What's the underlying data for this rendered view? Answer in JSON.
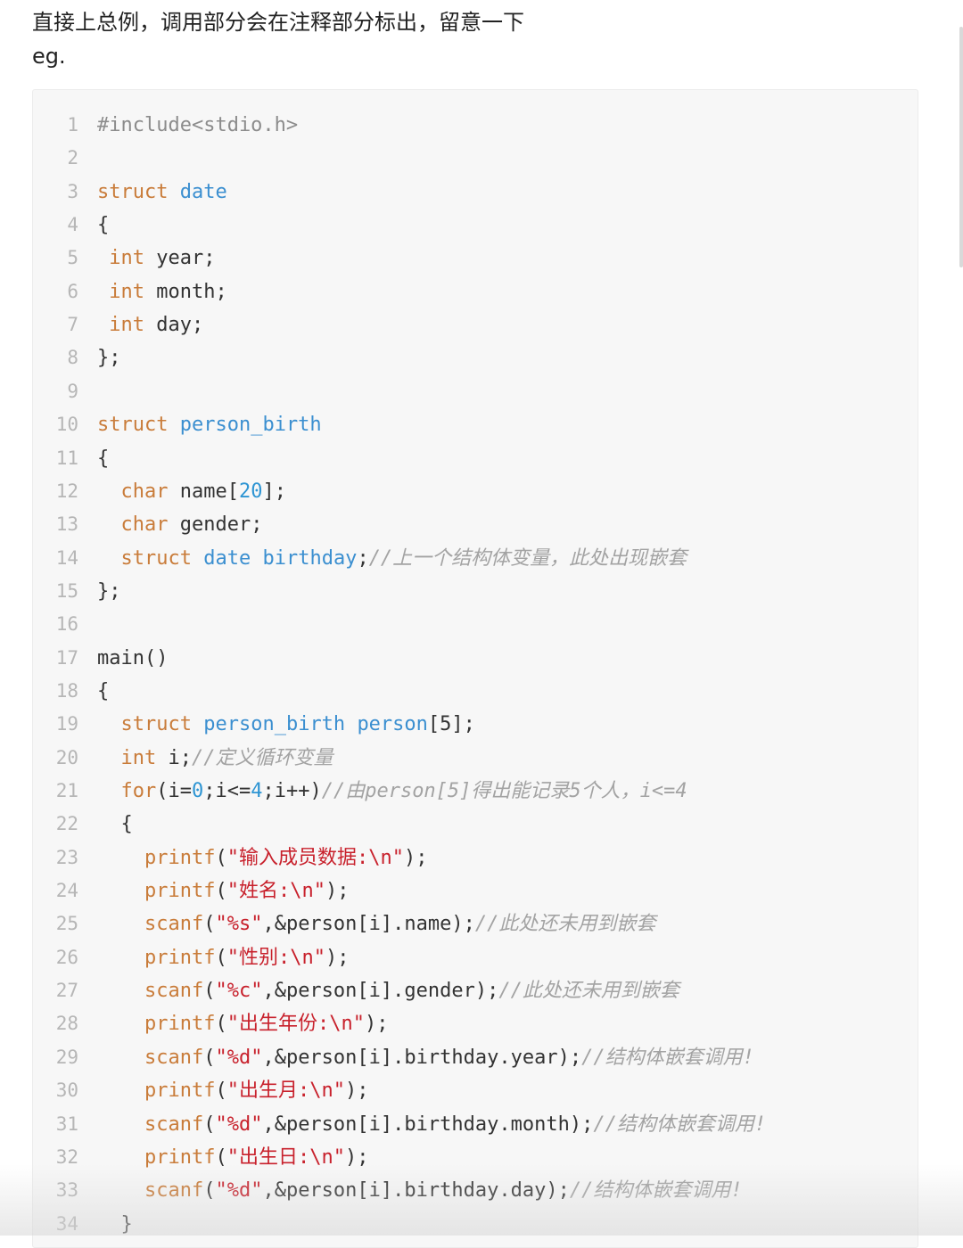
{
  "intro": {
    "line1": "直接上总例，调用部分会在注释部分标出，留意一下",
    "line2": "eg."
  },
  "colors": {
    "keyword": "#c97c3a",
    "type": "#3b8fd0",
    "number": "#2e95d3",
    "string": "#c8212c",
    "comment": "#a3a3a3",
    "preprocessor": "#8c8c8c",
    "text": "#333333",
    "line_number": "#b6b6b6",
    "code_background": "#f7f7f7"
  },
  "code": {
    "language": "c",
    "lines": [
      {
        "n": "1",
        "tokens": [
          {
            "t": "#include<stdio.h>",
            "c": "pre"
          }
        ]
      },
      {
        "n": "2",
        "tokens": []
      },
      {
        "n": "3",
        "tokens": [
          {
            "t": "struct",
            "c": "kw"
          },
          {
            "t": " "
          },
          {
            "t": "date",
            "c": "ty"
          }
        ]
      },
      {
        "n": "4",
        "tokens": [
          {
            "t": "{"
          }
        ]
      },
      {
        "n": "5",
        "tokens": [
          {
            "t": " "
          },
          {
            "t": "int",
            "c": "kw"
          },
          {
            "t": " year;"
          }
        ]
      },
      {
        "n": "6",
        "tokens": [
          {
            "t": " "
          },
          {
            "t": "int",
            "c": "kw"
          },
          {
            "t": " month;"
          }
        ]
      },
      {
        "n": "7",
        "tokens": [
          {
            "t": " "
          },
          {
            "t": "int",
            "c": "kw"
          },
          {
            "t": " day;"
          }
        ]
      },
      {
        "n": "8",
        "tokens": [
          {
            "t": "};"
          }
        ]
      },
      {
        "n": "9",
        "tokens": []
      },
      {
        "n": "10",
        "tokens": [
          {
            "t": "struct",
            "c": "kw"
          },
          {
            "t": " "
          },
          {
            "t": "person_birth",
            "c": "ty"
          }
        ]
      },
      {
        "n": "11",
        "tokens": [
          {
            "t": "{"
          }
        ]
      },
      {
        "n": "12",
        "tokens": [
          {
            "t": "  "
          },
          {
            "t": "char",
            "c": "kw"
          },
          {
            "t": " name["
          },
          {
            "t": "20",
            "c": "num"
          },
          {
            "t": "];"
          }
        ]
      },
      {
        "n": "13",
        "tokens": [
          {
            "t": "  "
          },
          {
            "t": "char",
            "c": "kw"
          },
          {
            "t": " gender;"
          }
        ]
      },
      {
        "n": "14",
        "tokens": [
          {
            "t": "  "
          },
          {
            "t": "struct",
            "c": "kw"
          },
          {
            "t": " "
          },
          {
            "t": "date",
            "c": "ty"
          },
          {
            "t": " "
          },
          {
            "t": "birthday",
            "c": "ty"
          },
          {
            "t": ";"
          },
          {
            "t": "//上一个结构体变量，此处出现嵌套",
            "c": "cmt"
          }
        ]
      },
      {
        "n": "15",
        "tokens": [
          {
            "t": "};"
          }
        ]
      },
      {
        "n": "16",
        "tokens": []
      },
      {
        "n": "17",
        "tokens": [
          {
            "t": "main()"
          }
        ]
      },
      {
        "n": "18",
        "tokens": [
          {
            "t": "{"
          }
        ]
      },
      {
        "n": "19",
        "tokens": [
          {
            "t": "  "
          },
          {
            "t": "struct",
            "c": "kw"
          },
          {
            "t": " "
          },
          {
            "t": "person_birth",
            "c": "ty"
          },
          {
            "t": " "
          },
          {
            "t": "person",
            "c": "ty"
          },
          {
            "t": "[5];"
          }
        ]
      },
      {
        "n": "20",
        "tokens": [
          {
            "t": "  "
          },
          {
            "t": "int",
            "c": "kw"
          },
          {
            "t": " i;"
          },
          {
            "t": "//定义循环变量",
            "c": "cmt"
          }
        ]
      },
      {
        "n": "21",
        "tokens": [
          {
            "t": "  "
          },
          {
            "t": "for",
            "c": "kw"
          },
          {
            "t": "(i="
          },
          {
            "t": "0",
            "c": "num"
          },
          {
            "t": ";i<="
          },
          {
            "t": "4",
            "c": "num"
          },
          {
            "t": ";i++)"
          },
          {
            "t": "//由person[5]得出能记录5个人，i<=4",
            "c": "cmt"
          }
        ]
      },
      {
        "n": "22",
        "tokens": [
          {
            "t": "  {"
          }
        ]
      },
      {
        "n": "23",
        "tokens": [
          {
            "t": "    "
          },
          {
            "t": "printf",
            "c": "kw"
          },
          {
            "t": "("
          },
          {
            "t": "\"输入成员数据:\\n\"",
            "c": "str"
          },
          {
            "t": ");"
          }
        ]
      },
      {
        "n": "24",
        "tokens": [
          {
            "t": "    "
          },
          {
            "t": "printf",
            "c": "kw"
          },
          {
            "t": "("
          },
          {
            "t": "\"姓名:\\n\"",
            "c": "str"
          },
          {
            "t": ");"
          }
        ]
      },
      {
        "n": "25",
        "tokens": [
          {
            "t": "    "
          },
          {
            "t": "scanf",
            "c": "kw"
          },
          {
            "t": "("
          },
          {
            "t": "\"%s\"",
            "c": "str"
          },
          {
            "t": ",&person[i].name);"
          },
          {
            "t": "//此处还未用到嵌套",
            "c": "cmt"
          }
        ]
      },
      {
        "n": "26",
        "tokens": [
          {
            "t": "    "
          },
          {
            "t": "printf",
            "c": "kw"
          },
          {
            "t": "("
          },
          {
            "t": "\"性别:\\n\"",
            "c": "str"
          },
          {
            "t": ");"
          }
        ]
      },
      {
        "n": "27",
        "tokens": [
          {
            "t": "    "
          },
          {
            "t": "scanf",
            "c": "kw"
          },
          {
            "t": "("
          },
          {
            "t": "\"%c\"",
            "c": "str"
          },
          {
            "t": ",&person[i].gender);"
          },
          {
            "t": "//此处还未用到嵌套",
            "c": "cmt"
          }
        ]
      },
      {
        "n": "28",
        "tokens": [
          {
            "t": "    "
          },
          {
            "t": "printf",
            "c": "kw"
          },
          {
            "t": "("
          },
          {
            "t": "\"出生年份:\\n\"",
            "c": "str"
          },
          {
            "t": ");"
          }
        ]
      },
      {
        "n": "29",
        "tokens": [
          {
            "t": "    "
          },
          {
            "t": "scanf",
            "c": "kw"
          },
          {
            "t": "("
          },
          {
            "t": "\"%d\"",
            "c": "str"
          },
          {
            "t": ",&person[i].birthday.year);"
          },
          {
            "t": "//结构体嵌套调用!",
            "c": "cmt"
          }
        ]
      },
      {
        "n": "30",
        "tokens": [
          {
            "t": "    "
          },
          {
            "t": "printf",
            "c": "kw"
          },
          {
            "t": "("
          },
          {
            "t": "\"出生月:\\n\"",
            "c": "str"
          },
          {
            "t": ");"
          }
        ]
      },
      {
        "n": "31",
        "tokens": [
          {
            "t": "    "
          },
          {
            "t": "scanf",
            "c": "kw"
          },
          {
            "t": "("
          },
          {
            "t": "\"%d\"",
            "c": "str"
          },
          {
            "t": ",&person[i].birthday.month);"
          },
          {
            "t": "//结构体嵌套调用!",
            "c": "cmt"
          }
        ]
      },
      {
        "n": "32",
        "tokens": [
          {
            "t": "    "
          },
          {
            "t": "printf",
            "c": "kw"
          },
          {
            "t": "("
          },
          {
            "t": "\"出生日:\\n\"",
            "c": "str"
          },
          {
            "t": ");"
          }
        ]
      },
      {
        "n": "33",
        "tokens": [
          {
            "t": "    "
          },
          {
            "t": "scanf",
            "c": "kw"
          },
          {
            "t": "("
          },
          {
            "t": "\"%d\"",
            "c": "str"
          },
          {
            "t": ",&person[i].birthday.day);"
          },
          {
            "t": "//结构体嵌套调用!",
            "c": "cmt"
          }
        ]
      },
      {
        "n": "34",
        "tokens": [
          {
            "t": "  }"
          }
        ]
      }
    ]
  }
}
